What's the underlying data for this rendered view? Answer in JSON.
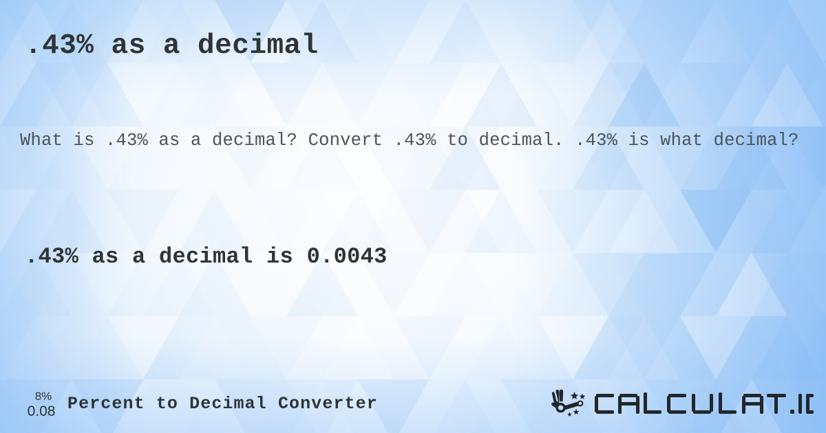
{
  "page": {
    "title": ".43% as a decimal",
    "description": "What is .43% as a decimal? Convert .43% to decimal. .43% is what decimal?",
    "answer": ".43% as a decimal is 0.0043"
  },
  "values": {
    "percent_input": ".43%",
    "decimal_result": "0.0043"
  },
  "footer": {
    "icon": {
      "name": "percent-to-decimal-icon",
      "percent_example": "8%",
      "decimal_example": "0.08"
    },
    "label": "Percent to Decimal Converter",
    "brand": {
      "name": "calculatio-logo",
      "wordmark": "CALCULAT.IO",
      "icon_name": "magic-wand-hand-icon"
    }
  },
  "theme": {
    "background_light": "#ffffff",
    "background_blue": "#8ec2f6",
    "background_mid": "#bedcfb",
    "text_dark": "#2f3437",
    "text_body": "#4c5357",
    "logo_color": "#21272b"
  }
}
